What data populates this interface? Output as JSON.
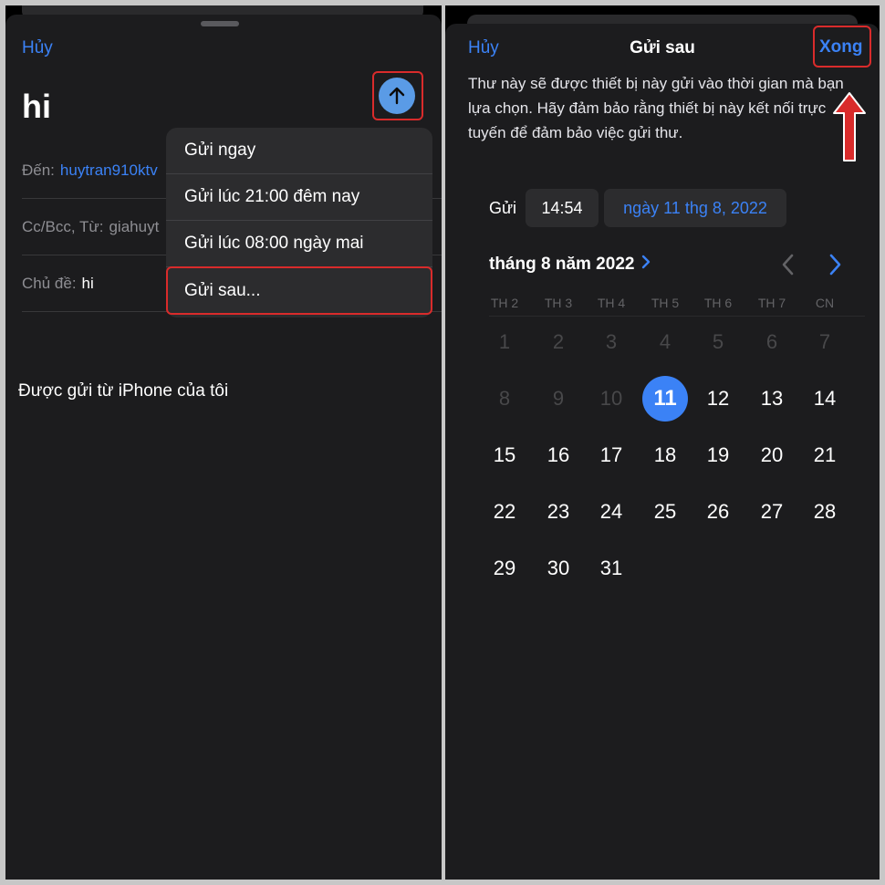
{
  "left": {
    "cancel_label": "Hủy",
    "subject_title": "hi",
    "fields": {
      "to_label": "Đến:",
      "to_value": "huytran910ktv",
      "ccbcc_label": "Cc/Bcc, Từ:",
      "ccbcc_value": "giahuyt",
      "subject_label": "Chủ đề:",
      "subject_value": "hi"
    },
    "signature": "Được gửi từ iPhone của tôi",
    "send_menu": [
      "Gửi ngay",
      "Gửi lúc 21:00 đêm nay",
      "Gửi lúc 08:00 ngày mai",
      "Gửi sau..."
    ]
  },
  "right": {
    "cancel_label": "Hủy",
    "title": "Gửi sau",
    "done_label": "Xong",
    "description": "Thư này sẽ được thiết bị này gửi vào thời gian mà bạn lựa chọn. Hãy đảm bảo rằng thiết bị này kết nối trực tuyến để đảm bảo việc gửi thư.",
    "send_label": "Gửi",
    "time_value": "14:54",
    "date_value": "ngày 11 thg 8, 2022",
    "month_label": "tháng 8 năm 2022",
    "weekdays": [
      "TH 2",
      "TH 3",
      "TH 4",
      "TH 5",
      "TH 6",
      "TH 7",
      "CN"
    ],
    "selected_day": 11,
    "days": [
      {
        "n": "1",
        "disabled": true
      },
      {
        "n": "2",
        "disabled": true
      },
      {
        "n": "3",
        "disabled": true
      },
      {
        "n": "4",
        "disabled": true
      },
      {
        "n": "5",
        "disabled": true
      },
      {
        "n": "6",
        "disabled": true
      },
      {
        "n": "7",
        "disabled": true
      },
      {
        "n": "8",
        "disabled": true
      },
      {
        "n": "9",
        "disabled": true
      },
      {
        "n": "10",
        "disabled": true
      },
      {
        "n": "11",
        "disabled": false
      },
      {
        "n": "12",
        "disabled": false
      },
      {
        "n": "13",
        "disabled": false
      },
      {
        "n": "14",
        "disabled": false
      },
      {
        "n": "15",
        "disabled": false
      },
      {
        "n": "16",
        "disabled": false
      },
      {
        "n": "17",
        "disabled": false
      },
      {
        "n": "18",
        "disabled": false
      },
      {
        "n": "19",
        "disabled": false
      },
      {
        "n": "20",
        "disabled": false
      },
      {
        "n": "21",
        "disabled": false
      },
      {
        "n": "22",
        "disabled": false
      },
      {
        "n": "23",
        "disabled": false
      },
      {
        "n": "24",
        "disabled": false
      },
      {
        "n": "25",
        "disabled": false
      },
      {
        "n": "26",
        "disabled": false
      },
      {
        "n": "27",
        "disabled": false
      },
      {
        "n": "28",
        "disabled": false
      },
      {
        "n": "29",
        "disabled": false
      },
      {
        "n": "30",
        "disabled": false
      },
      {
        "n": "31",
        "disabled": false
      }
    ]
  },
  "colors": {
    "accent": "#3b82f6",
    "highlight_red": "#d92b2b",
    "sheet_bg": "#1c1c1e",
    "menu_bg": "#2c2c2e"
  }
}
